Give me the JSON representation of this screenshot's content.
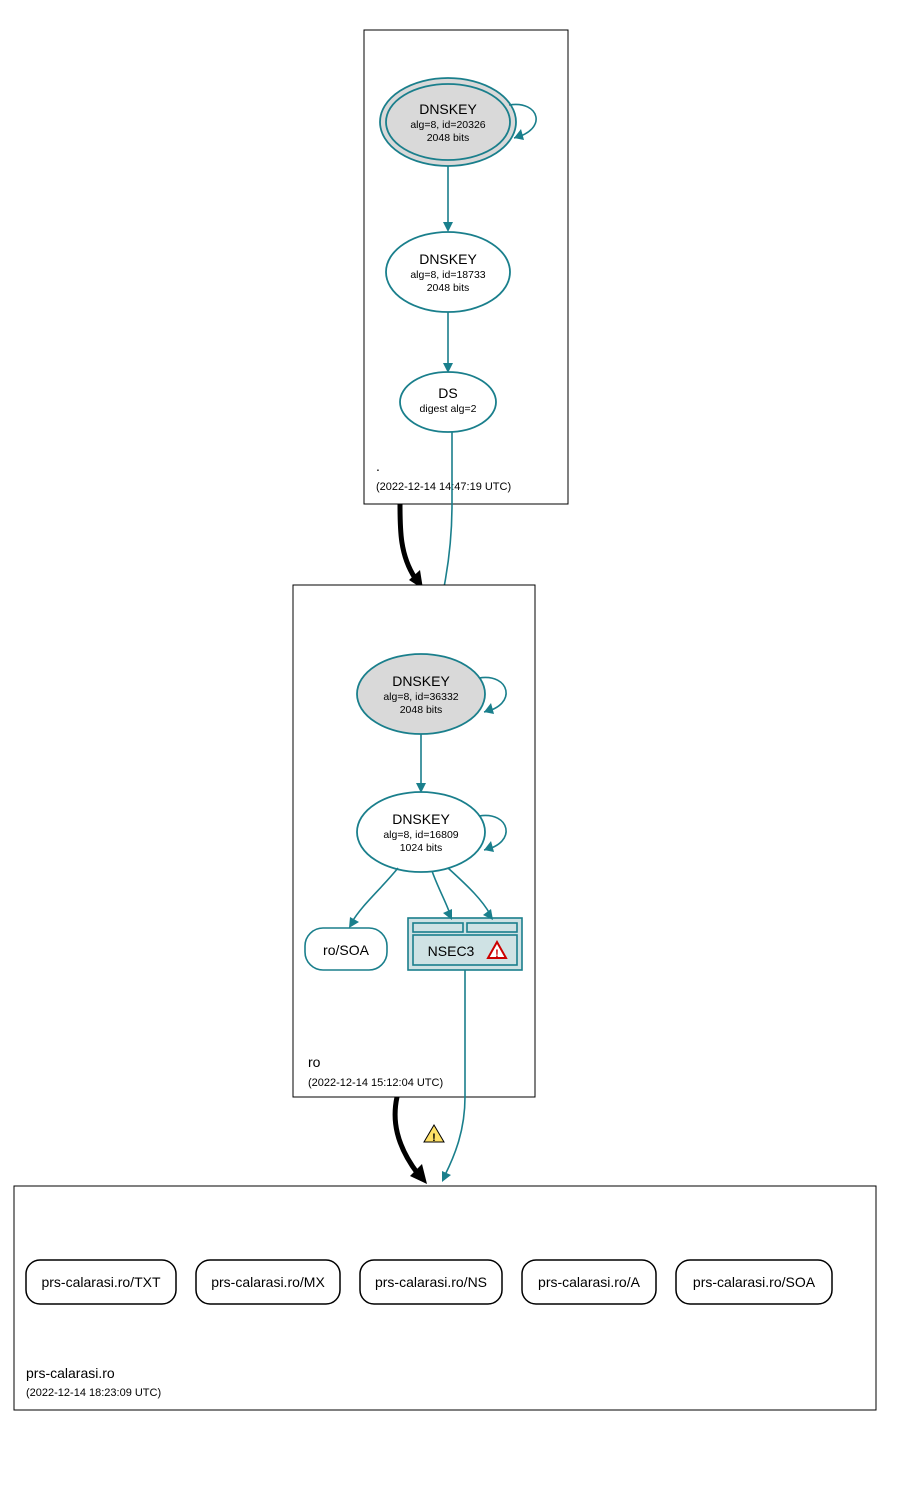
{
  "zones": {
    "root": {
      "label": ".",
      "timestamp": "(2022-12-14 14:47:19 UTC)",
      "nodes": {
        "ksk": {
          "title": "DNSKEY",
          "line2": "alg=8, id=20326",
          "line3": "2048 bits"
        },
        "zsk": {
          "title": "DNSKEY",
          "line2": "alg=8, id=18733",
          "line3": "2048 bits"
        },
        "ds": {
          "title": "DS",
          "line2": "digest alg=2"
        }
      }
    },
    "ro": {
      "label": "ro",
      "timestamp": "(2022-12-14 15:12:04 UTC)",
      "nodes": {
        "ksk": {
          "title": "DNSKEY",
          "line2": "alg=8, id=36332",
          "line3": "2048 bits"
        },
        "zsk": {
          "title": "DNSKEY",
          "line2": "alg=8, id=16809",
          "line3": "1024 bits"
        },
        "soa": {
          "label": "ro/SOA"
        },
        "nsec": {
          "label": "NSEC3"
        }
      }
    },
    "domain": {
      "label": "prs-calarasi.ro",
      "timestamp": "(2022-12-14 18:23:09 UTC)",
      "records": {
        "txt": "prs-calarasi.ro/TXT",
        "mx": "prs-calarasi.ro/MX",
        "ns": "prs-calarasi.ro/NS",
        "a": "prs-calarasi.ro/A",
        "soa": "prs-calarasi.ro/SOA"
      }
    }
  },
  "warnings": {
    "delegation": "warning",
    "nsec": "error"
  }
}
